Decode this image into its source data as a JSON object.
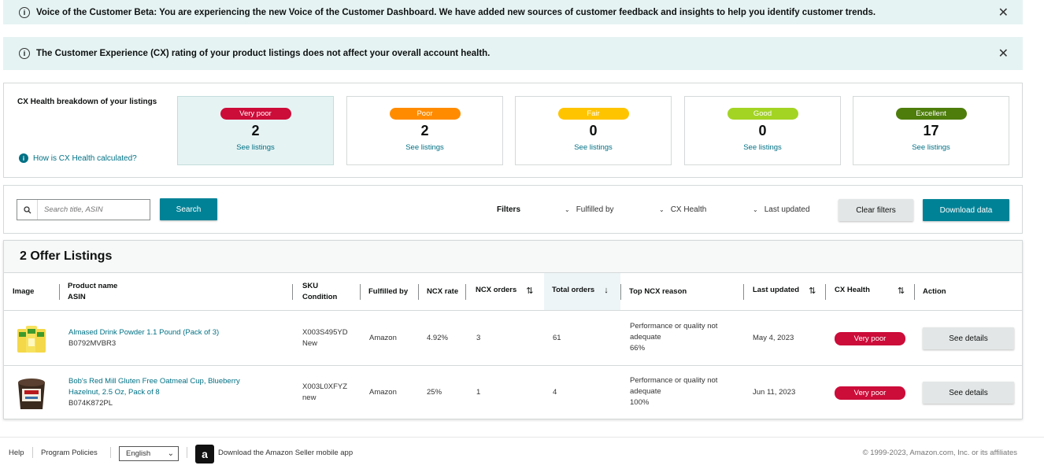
{
  "banners": [
    {
      "text": "Voice of the Customer Beta: You are experiencing the new Voice of the Customer Dashboard. We have added new sources of customer feedback and insights to help you identify customer trends.",
      "close": "✕"
    },
    {
      "text": "The Customer Experience (CX) rating of your product listings does not affect your overall account health.",
      "close": "✕"
    }
  ],
  "cx": {
    "title": "CX Health breakdown of your listings",
    "help": "How is CX Health calculated?",
    "cards": [
      {
        "label": "Very poor",
        "count": "2",
        "link": "See listings",
        "color": "#cc0c39"
      },
      {
        "label": "Poor",
        "count": "2",
        "link": "See listings",
        "color": "#ff8c00"
      },
      {
        "label": "Fair",
        "count": "0",
        "link": "See listings",
        "color": "#ffc400"
      },
      {
        "label": "Good",
        "count": "0",
        "link": "See listings",
        "color": "#a3d424"
      },
      {
        "label": "Excellent",
        "count": "17",
        "link": "See listings",
        "color": "#4e7d0c"
      }
    ]
  },
  "filters": {
    "search_placeholder": "Search title, ASIN",
    "search_button": "Search",
    "label": "Filters",
    "dropdowns": [
      "Fulfilled by",
      "CX Health",
      "Last updated"
    ],
    "clear": "Clear filters",
    "download": "Download data"
  },
  "listings": {
    "heading": "2 Offer Listings",
    "columns": {
      "image": "Image",
      "product_name": "Product name",
      "asin": "ASIN",
      "sku": "SKU",
      "condition": "Condition",
      "fulfilled_by": "Fulfilled by",
      "ncx_rate": "NCX rate",
      "ncx_orders": "NCX orders",
      "total_orders": "Total orders",
      "top_reason": "Top NCX reason",
      "last_updated": "Last updated",
      "cx_health": "CX Health",
      "action": "Action"
    },
    "rows": [
      {
        "name": "Almased Drink Powder 1.1 Pound (Pack of 3)",
        "asin": "B0792MVBR3",
        "sku": "X003S495YD",
        "condition": "New",
        "fulfilled_by": "Amazon",
        "ncx_rate": "4.92%",
        "ncx_orders": "3",
        "total_orders": "61",
        "reason_line1": "Performance or quality not",
        "reason_line2": "adequate",
        "reason_pct": "66%",
        "last_updated": "May 4, 2023",
        "cx_health": "Very poor",
        "action": "See details"
      },
      {
        "name": "Bob's Red Mill Gluten Free Oatmeal Cup, Blueberry Hazelnut, 2.5 Oz, Pack of 8",
        "asin": "B074K872PL",
        "sku": "X003L0XFYZ",
        "condition": "new",
        "fulfilled_by": "Amazon",
        "ncx_rate": "25%",
        "ncx_orders": "1",
        "total_orders": "4",
        "reason_line1": "Performance or quality not",
        "reason_line2": "adequate",
        "reason_pct": "100%",
        "last_updated": "Jun 11, 2023",
        "cx_health": "Very poor",
        "action": "See details"
      }
    ]
  },
  "footer": {
    "help": "Help",
    "policies": "Program Policies",
    "language": "English",
    "app": "Download the Amazon Seller mobile app",
    "copyright": "© 1999-2023, Amazon.com, Inc. or its affiliates"
  }
}
